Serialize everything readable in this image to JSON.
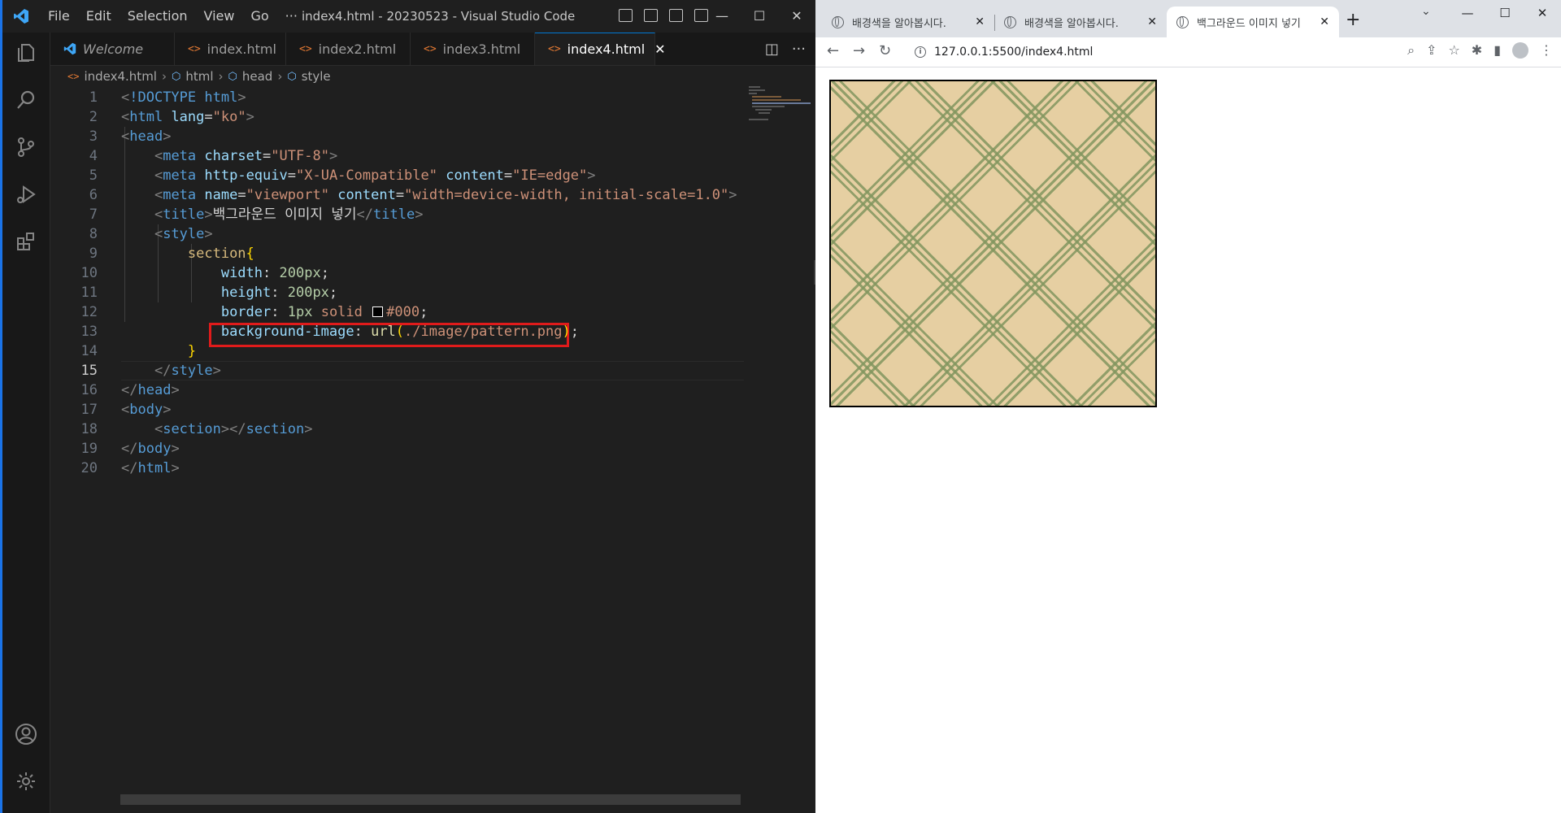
{
  "vscode": {
    "title": "index4.html - 20230523 - Visual Studio Code",
    "menu": [
      "File",
      "Edit",
      "Selection",
      "View",
      "Go",
      "···"
    ],
    "tabs": [
      {
        "label": "Welcome"
      },
      {
        "label": "index.html"
      },
      {
        "label": "index2.html"
      },
      {
        "label": "index3.html"
      },
      {
        "label": "index4.html",
        "active": true
      }
    ],
    "breadcrumb": [
      "index4.html",
      "html",
      "head",
      "style"
    ],
    "active_line": 15,
    "highlighted_line": 13,
    "code_lines": [
      {
        "n": "1",
        "tokens": [
          [
            "punct",
            "<"
          ],
          [
            "tag",
            "!DOCTYPE html"
          ],
          [
            "punct",
            ">"
          ]
        ]
      },
      {
        "n": "2",
        "tokens": [
          [
            "punct",
            "<"
          ],
          [
            "tag",
            "html "
          ],
          [
            "attr",
            "lang"
          ],
          [
            "text",
            "="
          ],
          [
            "str",
            "\"ko\""
          ],
          [
            "punct",
            ">"
          ]
        ]
      },
      {
        "n": "3",
        "tokens": [
          [
            "punct",
            "<"
          ],
          [
            "tag",
            "head"
          ],
          [
            "punct",
            ">"
          ]
        ]
      },
      {
        "n": "4",
        "tokens": [
          [
            "text",
            "    "
          ],
          [
            "punct",
            "<"
          ],
          [
            "tag",
            "meta "
          ],
          [
            "attr",
            "charset"
          ],
          [
            "text",
            "="
          ],
          [
            "str",
            "\"UTF-8\""
          ],
          [
            "punct",
            ">"
          ]
        ]
      },
      {
        "n": "5",
        "tokens": [
          [
            "text",
            "    "
          ],
          [
            "punct",
            "<"
          ],
          [
            "tag",
            "meta "
          ],
          [
            "attr",
            "http-equiv"
          ],
          [
            "text",
            "="
          ],
          [
            "str",
            "\"X-UA-Compatible\""
          ],
          [
            "text",
            " "
          ],
          [
            "attr",
            "content"
          ],
          [
            "text",
            "="
          ],
          [
            "str",
            "\"IE=edge\""
          ],
          [
            "punct",
            ">"
          ]
        ]
      },
      {
        "n": "6",
        "tokens": [
          [
            "text",
            "    "
          ],
          [
            "punct",
            "<"
          ],
          [
            "tag",
            "meta "
          ],
          [
            "attr",
            "name"
          ],
          [
            "text",
            "="
          ],
          [
            "str",
            "\"viewport\""
          ],
          [
            "text",
            " "
          ],
          [
            "attr",
            "content"
          ],
          [
            "text",
            "="
          ],
          [
            "str",
            "\"width=device-width, initial-scale=1.0\""
          ],
          [
            "punct",
            ">"
          ]
        ]
      },
      {
        "n": "7",
        "tokens": [
          [
            "text",
            "    "
          ],
          [
            "punct",
            "<"
          ],
          [
            "tag",
            "title"
          ],
          [
            "punct",
            ">"
          ],
          [
            "text",
            "백그라운드 이미지 넣기"
          ],
          [
            "punct",
            "</"
          ],
          [
            "tag",
            "title"
          ],
          [
            "punct",
            ">"
          ]
        ]
      },
      {
        "n": "8",
        "tokens": [
          [
            "text",
            "    "
          ],
          [
            "punct",
            "<"
          ],
          [
            "tag",
            "style"
          ],
          [
            "punct",
            ">"
          ]
        ]
      },
      {
        "n": "9",
        "tokens": [
          [
            "text",
            "        "
          ],
          [
            "sel",
            "section"
          ],
          [
            "brace",
            "{"
          ]
        ]
      },
      {
        "n": "10",
        "tokens": [
          [
            "text",
            "            "
          ],
          [
            "prop",
            "width"
          ],
          [
            "text",
            ": "
          ],
          [
            "num",
            "200px"
          ],
          [
            "text",
            ";"
          ]
        ]
      },
      {
        "n": "11",
        "tokens": [
          [
            "text",
            "            "
          ],
          [
            "prop",
            "height"
          ],
          [
            "text",
            ": "
          ],
          [
            "num",
            "200px"
          ],
          [
            "text",
            ";"
          ]
        ]
      },
      {
        "n": "12",
        "tokens": [
          [
            "text",
            "            "
          ],
          [
            "prop",
            "border"
          ],
          [
            "text",
            ": "
          ],
          [
            "num",
            "1px"
          ],
          [
            "text",
            " "
          ],
          [
            "val",
            "solid"
          ],
          [
            "text",
            " "
          ],
          [
            "swatch",
            ""
          ],
          [
            "val",
            "#000"
          ],
          [
            "text",
            ";"
          ]
        ]
      },
      {
        "n": "13",
        "tokens": [
          [
            "text",
            "            "
          ],
          [
            "prop",
            "background-image"
          ],
          [
            "text",
            ": "
          ],
          [
            "fn",
            "url"
          ],
          [
            "brace",
            "("
          ],
          [
            "val",
            "./image/pattern.png"
          ],
          [
            "brace",
            ")"
          ],
          [
            "text",
            ";"
          ]
        ]
      },
      {
        "n": "14",
        "tokens": [
          [
            "text",
            "        "
          ],
          [
            "brace",
            "}"
          ]
        ]
      },
      {
        "n": "15",
        "tokens": [
          [
            "text",
            "    "
          ],
          [
            "punct",
            "</"
          ],
          [
            "tag",
            "style"
          ],
          [
            "punct",
            ">"
          ]
        ]
      },
      {
        "n": "16",
        "tokens": [
          [
            "punct",
            "</"
          ],
          [
            "tag",
            "head"
          ],
          [
            "punct",
            ">"
          ]
        ]
      },
      {
        "n": "17",
        "tokens": [
          [
            "punct",
            "<"
          ],
          [
            "tag",
            "body"
          ],
          [
            "punct",
            ">"
          ]
        ]
      },
      {
        "n": "18",
        "tokens": [
          [
            "text",
            "    "
          ],
          [
            "punct",
            "<"
          ],
          [
            "tag",
            "section"
          ],
          [
            "punct",
            "></"
          ],
          [
            "tag",
            "section"
          ],
          [
            "punct",
            ">"
          ]
        ]
      },
      {
        "n": "19",
        "tokens": [
          [
            "punct",
            "</"
          ],
          [
            "tag",
            "body"
          ],
          [
            "punct",
            ">"
          ]
        ]
      },
      {
        "n": "20",
        "tokens": [
          [
            "punct",
            "</"
          ],
          [
            "tag",
            "html"
          ],
          [
            "punct",
            ">"
          ]
        ]
      }
    ]
  },
  "browser": {
    "tabs": [
      {
        "label": "배경색을 알아봅시다."
      },
      {
        "label": "배경색을 알아봅시다."
      },
      {
        "label": "백그라운드 이미지 넣기",
        "active": true
      }
    ],
    "url": "127.0.0.1:5500/index4.html",
    "colors": {
      "pattern_bg": "#e6cfa2",
      "pattern_lines": "#82965f"
    }
  },
  "icons": {
    "vscode_logo": "vscode-logo-icon",
    "activity": [
      "explorer-icon",
      "search-icon",
      "source-control-icon",
      "run-debug-icon",
      "extensions-icon",
      "account-icon",
      "settings-gear-icon"
    ]
  }
}
